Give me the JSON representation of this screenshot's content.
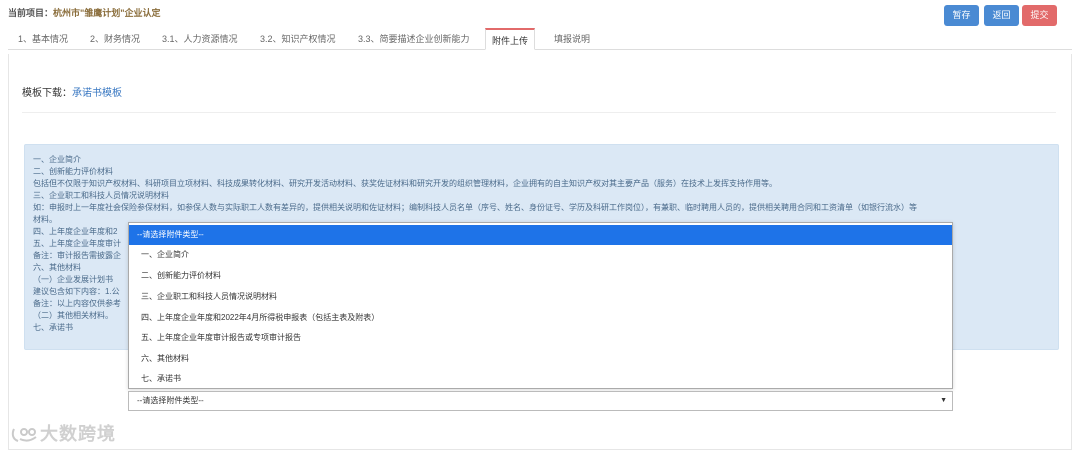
{
  "header": {
    "prefix": "当前项目：",
    "project": "杭州市\"雏鹰计划\"企业认定",
    "save_label": "暂存",
    "back_label": "返回",
    "submit_label": "提交"
  },
  "tabs": [
    {
      "label": "1、基本情况"
    },
    {
      "label": "2、财务情况"
    },
    {
      "label": "3.1、人力资源情况"
    },
    {
      "label": "3.2、知识产权情况"
    },
    {
      "label": "3.3、简要描述企业创新能力"
    },
    {
      "label": "附件上传",
      "active": true
    },
    {
      "label": "填报说明"
    }
  ],
  "template": {
    "label": "模板下载：",
    "link": "承诺书模板"
  },
  "info": {
    "lines": [
      "一、企业简介",
      "二、创新能力评价材料",
      "包括但不仅限于知识产权材料、科研项目立项材料、科技成果转化材料、研究开发活动材料、获奖佐证材料和研究开发的组织管理材料，企业拥有的自主知识产权对其主要产品（服务）在技术上发挥支持作用等。",
      "三、企业职工和科技人员情况说明材料",
      "如：申报时上一年度社会保险参保材料，如参保人数与实际职工人数有差异的，提供相关说明和佐证材料；编制科技人员名单（序号、姓名、身份证号、学历及科研工作岗位），有兼职、临时聘用人员的，提供相关聘用合同和工资清单（如银行流水）等",
      "材料。",
      "四、上年度企业年度和2",
      "五、上年度企业年度审计",
      "备注：审计报告需披露企",
      "六、其他材料",
      "（一）企业发展计划书",
      "建议包含如下内容：1.公",
      "备注：以上内容仅供参考",
      "（二）其他相关材料。",
      "七、承诺书"
    ]
  },
  "dropdown": {
    "placeholder": "--请选择附件类型--",
    "options": [
      "--请选择附件类型--",
      "一、企业简介",
      "二、创新能力评价材料",
      "三、企业职工和科技人员情况说明材料",
      "四、上年度企业年度和2022年4月所得税申报表（包括主表及附表）",
      "五、上年度企业年度审计报告或专项审计报告",
      "六、其他材料",
      "七、承诺书"
    ],
    "selected": "--请选择附件类型--",
    "arrow": "▼"
  },
  "watermark": {
    "text": "大数跨境"
  },
  "colors": {
    "primary": "#4a8ad3",
    "danger": "#e26a6a",
    "info_bg": "#dbe8f5",
    "highlight": "#1e73e8"
  }
}
